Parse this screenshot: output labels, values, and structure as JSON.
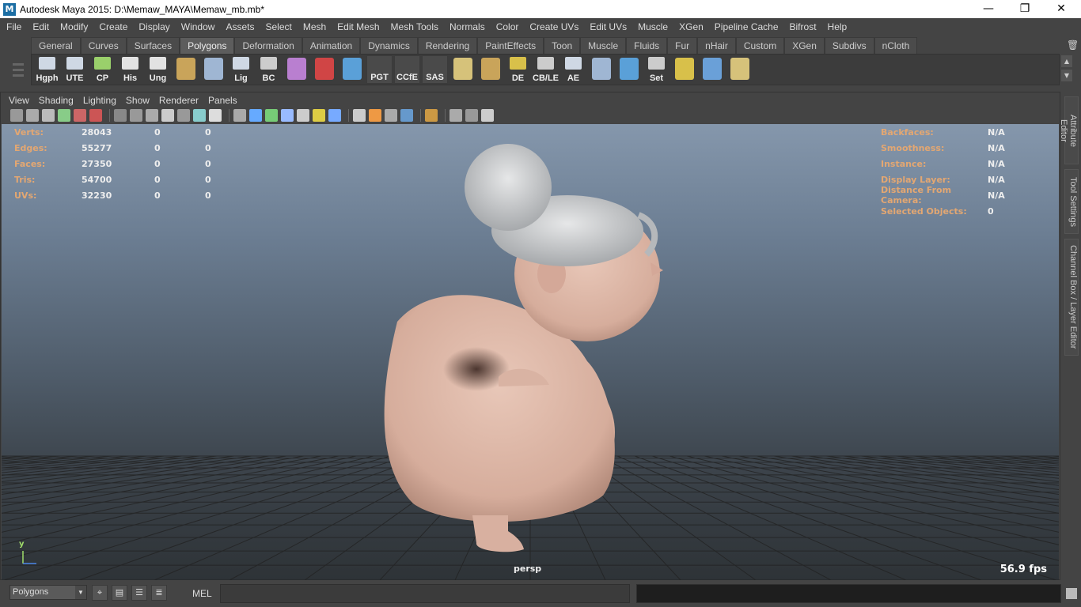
{
  "window": {
    "title": "Autodesk Maya 2015: D:\\Memaw_MAYA\\Memaw_mb.mb*",
    "app_icon": "M",
    "minimize": "—",
    "restore": "❐",
    "close": "✕"
  },
  "menubar": [
    "File",
    "Edit",
    "Modify",
    "Create",
    "Display",
    "Window",
    "Assets",
    "Select",
    "Mesh",
    "Edit Mesh",
    "Mesh Tools",
    "Normals",
    "Color",
    "Create UVs",
    "Edit UVs",
    "Muscle",
    "XGen",
    "Pipeline Cache",
    "Bifrost",
    "Help"
  ],
  "shelf": {
    "tabs": [
      "General",
      "Curves",
      "Surfaces",
      "Polygons",
      "Deformation",
      "Animation",
      "Dynamics",
      "Rendering",
      "PaintEffects",
      "Toon",
      "Muscle",
      "Fluids",
      "Fur",
      "nHair",
      "Custom",
      "XGen",
      "Subdivs",
      "nCloth"
    ],
    "active_tab": "Polygons",
    "buttons": [
      {
        "label": "Hgph",
        "color": "#cfd8e4"
      },
      {
        "label": "UTE",
        "color": "#cfd8e4"
      },
      {
        "label": "CP",
        "color": "#9ad06b"
      },
      {
        "label": "His",
        "color": "#e2e2e2"
      },
      {
        "label": "Ung",
        "color": "#e2e2e2"
      },
      {
        "label": "",
        "color": "#c9a45a"
      },
      {
        "label": "",
        "color": "#9fb6d3"
      },
      {
        "label": "Lig",
        "color": "#cfd8e4"
      },
      {
        "label": "BC",
        "color": "#cccccc"
      },
      {
        "label": "",
        "color": "#b97fd0"
      },
      {
        "label": "",
        "color": "#d04545"
      },
      {
        "label": "",
        "color": "#5aa0d8"
      },
      {
        "label": "PGT",
        "color": ""
      },
      {
        "label": "CCfE",
        "color": ""
      },
      {
        "label": "SAS",
        "color": ""
      },
      {
        "label": "",
        "color": "#d6c27a"
      },
      {
        "label": "",
        "color": "#c9a45a"
      },
      {
        "label": "DE",
        "color": "#d8c04a"
      },
      {
        "label": "CB/LE",
        "color": "#cccccc"
      },
      {
        "label": "AE",
        "color": "#cfd8e4"
      },
      {
        "label": "",
        "color": "#9fb6d3"
      },
      {
        "label": "",
        "color": "#5aa0d8"
      },
      {
        "label": "Set",
        "color": "#cccccc"
      },
      {
        "label": "",
        "color": "#d8c04a"
      },
      {
        "label": "",
        "color": "#6aa0d8"
      },
      {
        "label": "",
        "color": "#d6c27a"
      }
    ]
  },
  "panel": {
    "menu": [
      "View",
      "Shading",
      "Lighting",
      "Show",
      "Renderer",
      "Panels"
    ],
    "hud_left": [
      {
        "key": "Verts:",
        "v1": "28043",
        "v2": "0",
        "v3": "0"
      },
      {
        "key": "Edges:",
        "v1": "55277",
        "v2": "0",
        "v3": "0"
      },
      {
        "key": "Faces:",
        "v1": "27350",
        "v2": "0",
        "v3": "0"
      },
      {
        "key": "Tris:",
        "v1": "54700",
        "v2": "0",
        "v3": "0"
      },
      {
        "key": "UVs:",
        "v1": "32230",
        "v2": "0",
        "v3": "0"
      }
    ],
    "hud_right": [
      {
        "key": "Backfaces:",
        "value": "N/A"
      },
      {
        "key": "Smoothness:",
        "value": "N/A"
      },
      {
        "key": "Instance:",
        "value": "N/A"
      },
      {
        "key": "Display Layer:",
        "value": "N/A"
      },
      {
        "key": "Distance From Camera:",
        "value": "N/A"
      },
      {
        "key": "Selected Objects:",
        "value": "0"
      }
    ],
    "camera": "persp",
    "fps": "56.9 fps",
    "axis_label": "y"
  },
  "side_tabs": [
    "Attribute Editor",
    "Tool Settings",
    "Channel Box / Layer Editor"
  ],
  "cmdbar": {
    "mode": "Polygons",
    "mel_label": "MEL"
  },
  "colors": {
    "hud_key": "#e3a772",
    "skin": "#d9b3a3",
    "hair": "#c9cbcd"
  }
}
